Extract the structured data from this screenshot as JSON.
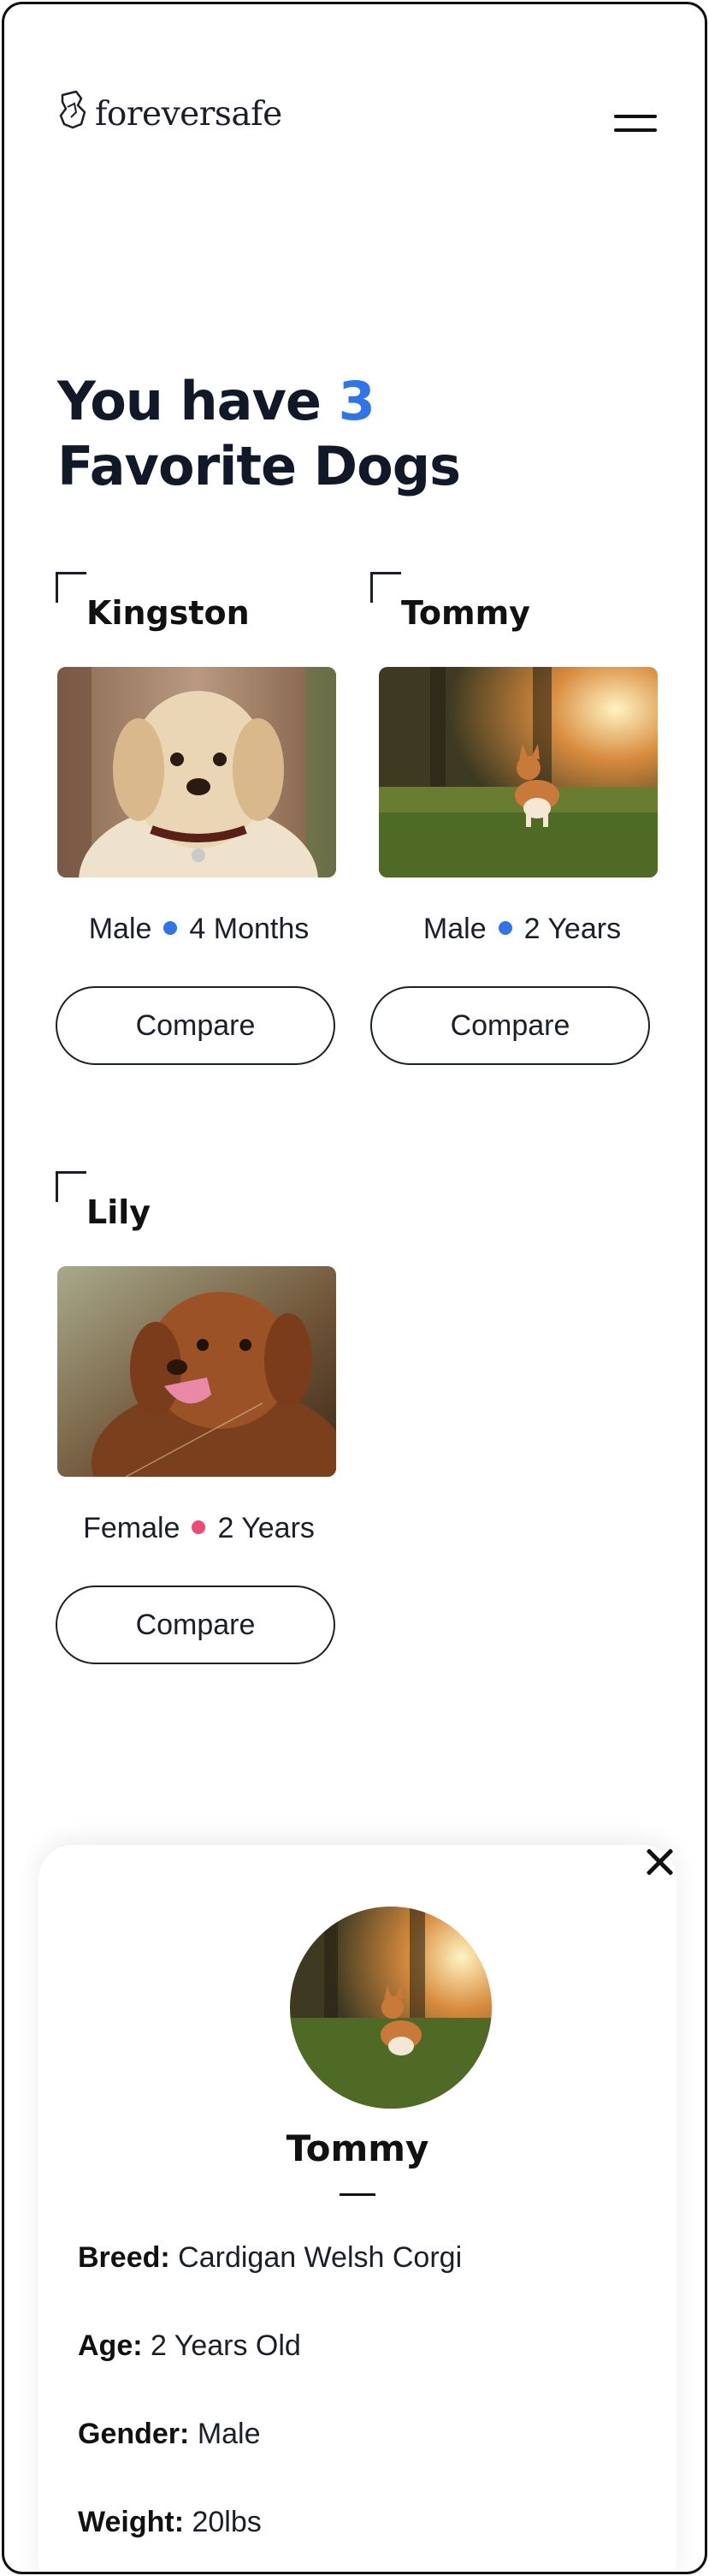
{
  "header": {
    "logo_text": "foreversafe",
    "logo_icon": "foreversafe-logo-icon",
    "menu_icon": "hamburger-menu-icon"
  },
  "title": {
    "prefix": "You have",
    "count": "3",
    "suffix": "Favorite Dogs"
  },
  "colors": {
    "accent": "#2f74e8",
    "male_dot": "#2f74e8",
    "female_dot": "#ee4a78",
    "text": "#1b1f29"
  },
  "dogs": [
    {
      "name": "Kingston",
      "gender": "Male",
      "age": "4 Months",
      "compare_label": "Compare",
      "photo": "golden-retriever-puppy"
    },
    {
      "name": "Tommy",
      "gender": "Male",
      "age": "2 Years",
      "compare_label": "Compare",
      "photo": "corgi-in-sunlit-park"
    },
    {
      "name": "Lily",
      "gender": "Female",
      "age": "2 Years",
      "compare_label": "Compare",
      "photo": "brown-retriever-smiling"
    }
  ],
  "detail": {
    "name": "Tommy",
    "close_icon": "close-icon",
    "rows": [
      {
        "label": "Breed:",
        "value": "Cardigan Welsh Corgi"
      },
      {
        "label": "Age:",
        "value": "2 Years Old"
      },
      {
        "label": "Gender:",
        "value": "Male"
      },
      {
        "label": "Weight:",
        "value": "20lbs"
      }
    ]
  }
}
